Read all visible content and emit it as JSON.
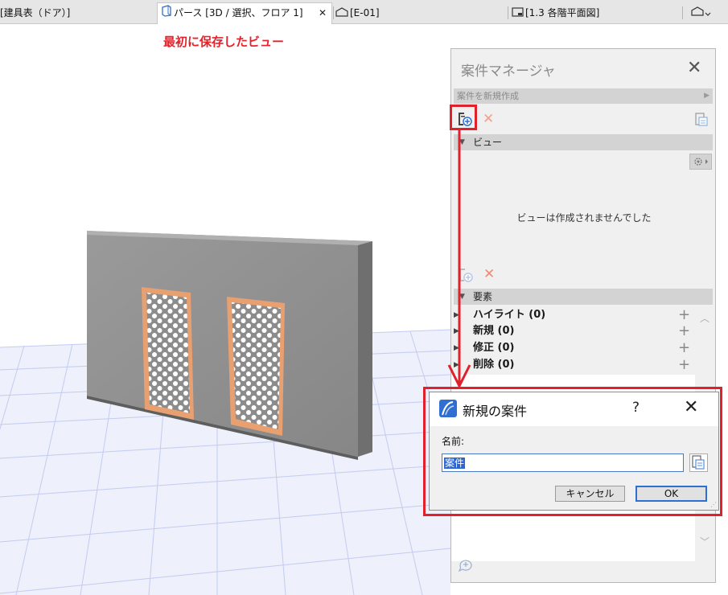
{
  "tabs": [
    {
      "label": "[建具表（ドア）]"
    },
    {
      "label": "パース [3D / 選択、フロア 1]"
    },
    {
      "label": "[E-01]"
    },
    {
      "label": "[1.3 各階平面図]"
    }
  ],
  "annotation": {
    "text": "最初に保存したビュー"
  },
  "project_manager": {
    "title": "案件マネージャ",
    "create_bar": "案件を新規作成",
    "views_section": "ビュー",
    "no_views_text": "ビューは作成されませんでした",
    "elements_section": "要素",
    "element_rows": [
      {
        "label": "ハイライト (0)"
      },
      {
        "label": "新規 (0)"
      },
      {
        "label": "修正 (0)"
      },
      {
        "label": "削除 (0)"
      }
    ]
  },
  "dialog": {
    "title": "新規の案件",
    "help_label": "?",
    "name_label": "名前:",
    "name_value": "案件",
    "cancel_label": "キャンセル",
    "ok_label": "OK"
  },
  "colors": {
    "highlight": "#e0202a",
    "accent": "#2d6fd2",
    "wall": "#8f8f8f",
    "door_frame": "#e8a070",
    "grid": "#c3cbf1"
  }
}
